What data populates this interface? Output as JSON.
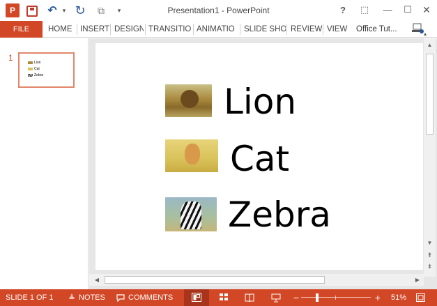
{
  "app": {
    "title": "Presentation1 - PowerPoint",
    "logo_letter": "P"
  },
  "qat": {
    "save_icon": "save-icon",
    "undo_glyph": "↶",
    "dropdown_glyph": "▾",
    "redo_glyph": "↻",
    "present_glyph": "⧉",
    "customize_glyph": "▾"
  },
  "window": {
    "help": "?",
    "ribbon_options": "⬚",
    "minimize": "—",
    "maximize": "☐",
    "close": "✕"
  },
  "ribbon": {
    "file": "FILE",
    "tabs": [
      "HOME",
      "INSERT",
      "DESIGN",
      "TRANSITIO",
      "ANIMATIO",
      "SLIDE SHO",
      "REVIEW",
      "VIEW"
    ],
    "account": "Office Tut...",
    "collapse": "▴"
  },
  "thumbnails": {
    "slide_number": "1",
    "items": [
      "Lion",
      "Cat",
      "Zebra"
    ]
  },
  "slide": {
    "items": [
      {
        "label": "Lion",
        "image": "lion-photo"
      },
      {
        "label": "Cat",
        "image": "kitten-photo"
      },
      {
        "label": "Zebra",
        "image": "zebra-photo"
      }
    ]
  },
  "scroll": {
    "up": "▲",
    "down": "▼",
    "prev_slide": "⇞",
    "next_slide": "⇟",
    "left": "◀",
    "right": "▶"
  },
  "status": {
    "slide_indicator": "SLIDE 1 OF 1",
    "notes": "NOTES",
    "comments": "COMMENTS",
    "zoom_minus": "−",
    "zoom_plus": "+",
    "zoom_percent": "51%",
    "zoom_level": 0.51
  },
  "colors": {
    "accent": "#D24726",
    "accent_dark": "#A8351B"
  }
}
